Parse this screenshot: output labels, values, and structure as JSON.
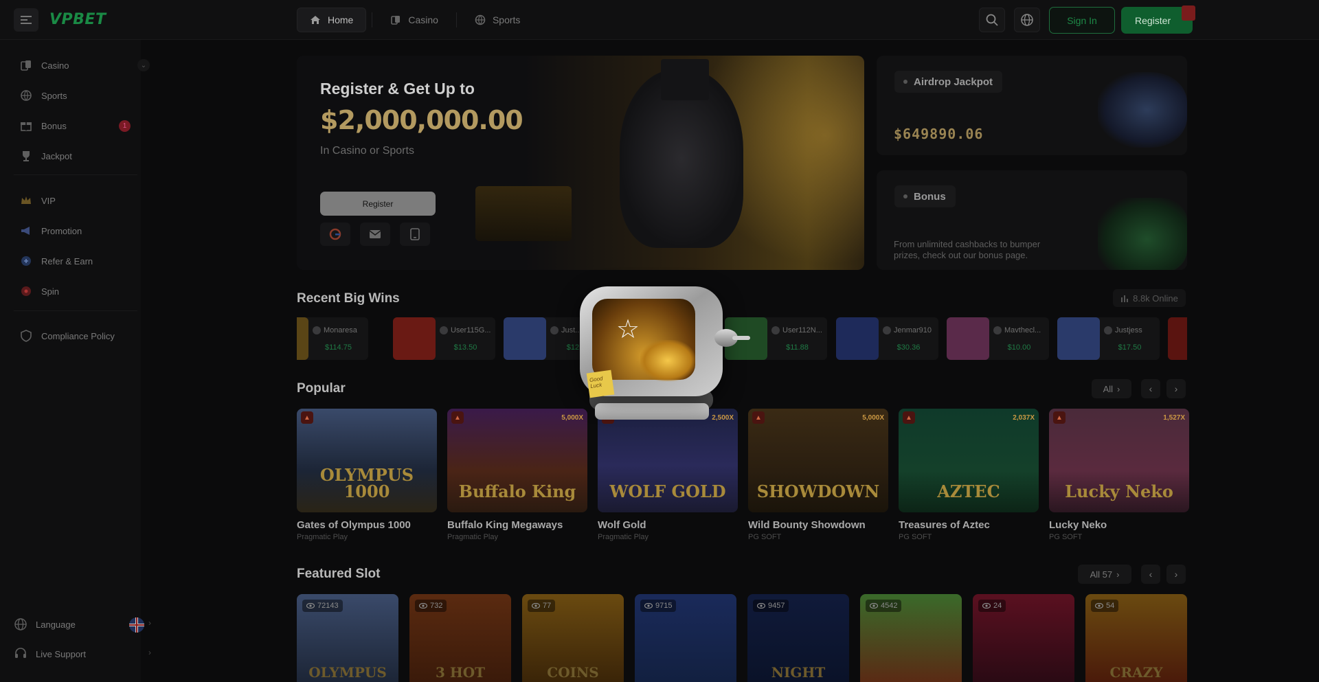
{
  "brand": {
    "logo": "VPBET",
    "accent": "#1a8a45"
  },
  "header": {
    "nav": [
      {
        "label": "Home",
        "icon": "home-icon"
      },
      {
        "label": "Casino",
        "icon": "cards-icon"
      },
      {
        "label": "Sports",
        "icon": "ball-icon"
      }
    ],
    "sign_in": "Sign In",
    "register": "Register"
  },
  "sidebar": {
    "items": [
      {
        "label": "Casino",
        "icon": "cards-icon"
      },
      {
        "label": "Sports",
        "icon": "ball-icon"
      },
      {
        "label": "Bonus",
        "icon": "gift-icon",
        "badge": "1"
      },
      {
        "label": "Jackpot",
        "icon": "trophy-icon"
      },
      {
        "label": "VIP",
        "icon": "crown-icon"
      },
      {
        "label": "Promotion",
        "icon": "megaphone-icon"
      },
      {
        "label": "Refer & Earn",
        "icon": "refer-icon"
      },
      {
        "label": "Spin",
        "icon": "wheel-icon"
      },
      {
        "label": "Compliance Policy",
        "icon": "shield-icon"
      }
    ],
    "language": "Language",
    "live_support": "Live Support"
  },
  "hero": {
    "title": "Register & Get Up to",
    "amount": "$2,000,000.00",
    "subtitle": "In Casino or Sports",
    "register": "Register"
  },
  "promos": {
    "jackpot": {
      "tag": "Airdrop Jackpot",
      "value": "$649890.06"
    },
    "bonus": {
      "tag": "Bonus",
      "text": "From unlimited cashbacks to bumper prizes, check out our bonus page."
    }
  },
  "recent_wins": {
    "title": "Recent Big Wins",
    "online": "8.8k Online",
    "items": [
      {
        "user": "Monaresa",
        "amount": "$114.75",
        "color": "#5a4516"
      },
      {
        "user": "User115G...",
        "amount": "$13.50",
        "color": "#6a1a14"
      },
      {
        "user": "Just...",
        "amount": "$12...",
        "color": "#2a3a6a"
      },
      {
        "user": "",
        "amount": "",
        "color": "#2a2a2a"
      },
      {
        "user": "User112N...",
        "amount": "$11.88",
        "color": "#1f4a24"
      },
      {
        "user": "Jenmar910",
        "amount": "$30.36",
        "color": "#1e2a5a"
      },
      {
        "user": "Mavthecl...",
        "amount": "$10.00",
        "color": "#5a2a4a"
      },
      {
        "user": "Justjess",
        "amount": "$17.50",
        "color": "#2a3a6a"
      }
    ]
  },
  "popular": {
    "title": "Popular",
    "all_label": "All",
    "games": [
      {
        "name": "Gates of Olympus 1000",
        "provider": "Pragmatic Play",
        "art": "OLYMPUS 1000",
        "mult": "",
        "bg": "linear-gradient(180deg,#3a4a6a,#1c2536 60%,#2a2416)"
      },
      {
        "name": "Buffalo King Megaways",
        "provider": "Pragmatic Play",
        "art": "Buffalo King",
        "mult": "5,000X",
        "bg": "linear-gradient(180deg,#3a1a4a,#4a2416 60%,#2a1a10)"
      },
      {
        "name": "Wolf Gold",
        "provider": "Pragmatic Play",
        "art": "WOLF GOLD",
        "mult": "2,500X",
        "bg": "linear-gradient(180deg,#1c2040,#2a2a5a 55%,#1a1a30)"
      },
      {
        "name": "Wild Bounty Showdown",
        "provider": "PG SOFT",
        "art": "SHOWDOWN",
        "mult": "5,000X",
        "bg": "linear-gradient(180deg,#3a2a14,#2a1e10 60%,#1a140a)"
      },
      {
        "name": "Treasures of Aztec",
        "provider": "PG SOFT",
        "art": "AZTEC",
        "mult": "2,037X",
        "bg": "linear-gradient(180deg,#0f3a2a,#14402a 60%,#0c2416)"
      },
      {
        "name": "Lucky Neko",
        "provider": "PG SOFT",
        "art": "Lucky Neko",
        "mult": "1,527X",
        "bg": "linear-gradient(180deg,#4a2a3a,#5a2a3e 60%,#2a1620)"
      }
    ]
  },
  "featured": {
    "title": "Featured Slot",
    "all_label": "All 57",
    "games": [
      {
        "views": "72143",
        "art": "OLYMPUS",
        "bg": "linear-gradient(180deg,#3a4a6a,#1c2536)"
      },
      {
        "views": "732",
        "art": "3 HOT",
        "bg": "linear-gradient(180deg,#5a2a10,#3a1a0a)"
      },
      {
        "views": "77",
        "art": "COINS",
        "bg": "linear-gradient(180deg,#6a4a10,#3a2408)"
      },
      {
        "views": "9715",
        "art": "",
        "bg": "linear-gradient(180deg,#1a2a5a,#122040)"
      },
      {
        "views": "9457",
        "art": "NIGHT",
        "bg": "linear-gradient(180deg,#101a3a,#0a1228)"
      },
      {
        "views": "4542",
        "art": "",
        "bg": "linear-gradient(180deg,#3a6a2a,#5a2a14)"
      },
      {
        "views": "24",
        "art": "",
        "bg": "linear-gradient(180deg,#5a1020,#2a0a14)"
      },
      {
        "views": "54",
        "art": "CRAZY",
        "bg": "linear-gradient(180deg,#6a4a10,#4a1a0a)"
      }
    ]
  },
  "overlay": {
    "note": "Good Luck"
  }
}
